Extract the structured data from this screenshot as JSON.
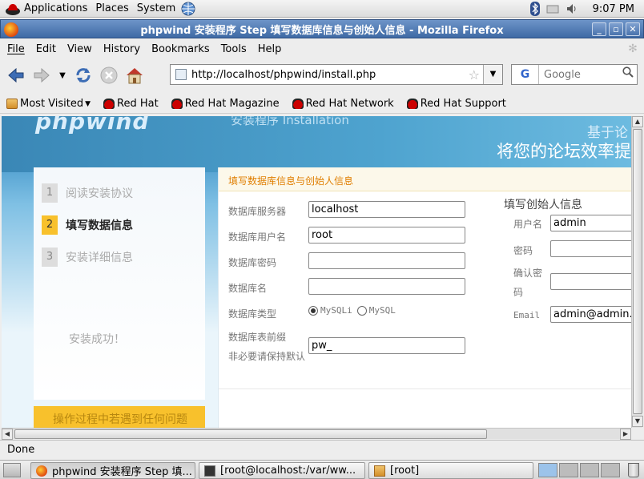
{
  "panel": {
    "menus": [
      "Applications",
      "Places",
      "System"
    ],
    "clock": "9:07 PM"
  },
  "window": {
    "title": "phpwind 安装程序 Step 填写数据库信息与创始人信息 - Mozilla Firefox",
    "buttons": {
      "minimize": "_",
      "maximize": "▫",
      "close": "✕"
    }
  },
  "menubar": [
    "File",
    "Edit",
    "View",
    "History",
    "Bookmarks",
    "Tools",
    "Help"
  ],
  "navbar": {
    "url": "http://localhost/phpwind/install.php",
    "search_engine": "G",
    "search_placeholder": "Google"
  },
  "bookmarks": [
    "Most Visited",
    "Red Hat",
    "Red Hat Magazine",
    "Red Hat Network",
    "Red Hat Support"
  ],
  "page": {
    "logo": "phpwind",
    "banner_title": "安装程序 Installation",
    "banner_kicker": "基于论",
    "banner_slogan": "将您的论坛效率提",
    "steps": [
      {
        "num": "1",
        "label": "阅读安装协议",
        "active": false
      },
      {
        "num": "2",
        "label": "填写数据信息",
        "active": true
      },
      {
        "num": "3",
        "label": "安装详细信息",
        "active": false
      }
    ],
    "step_done": "安装成功！",
    "help_text": "操作过程中若遇到任何问题",
    "panel_title": "填写数据库信息与创始人信息",
    "db": {
      "server_label": "数据库服务器",
      "server_value": "localhost",
      "user_label": "数据库用户名",
      "user_value": "root",
      "pass_label": "数据库密码",
      "pass_value": "",
      "name_label": "数据库名",
      "name_value": "",
      "type_label": "数据库类型",
      "type_options": [
        "MySQLi",
        "MySQL"
      ],
      "type_selected": "MySQLi",
      "prefix_label": "数据库表前缀",
      "prefix_note": "非必要请保持默认",
      "prefix_value": "pw_"
    },
    "admin": {
      "title": "填写创始人信息",
      "user_label": "用户名",
      "user_value": "admin",
      "pass_label": "密码",
      "pass_value": "",
      "confirm_label_1": "确认密",
      "confirm_label_2": "码",
      "confirm_value": "",
      "email_label": "Email",
      "email_value": "admin@admin."
    }
  },
  "status": "Done",
  "taskbar": {
    "tasks": [
      "phpwind 安装程序 Step 填...",
      "[root@localhost:/var/ww...",
      "[root]"
    ]
  },
  "colors": {
    "accent_orange": "#f8c12c",
    "title_bar": "#3f6aa5",
    "panel_title": "#e07e00"
  }
}
